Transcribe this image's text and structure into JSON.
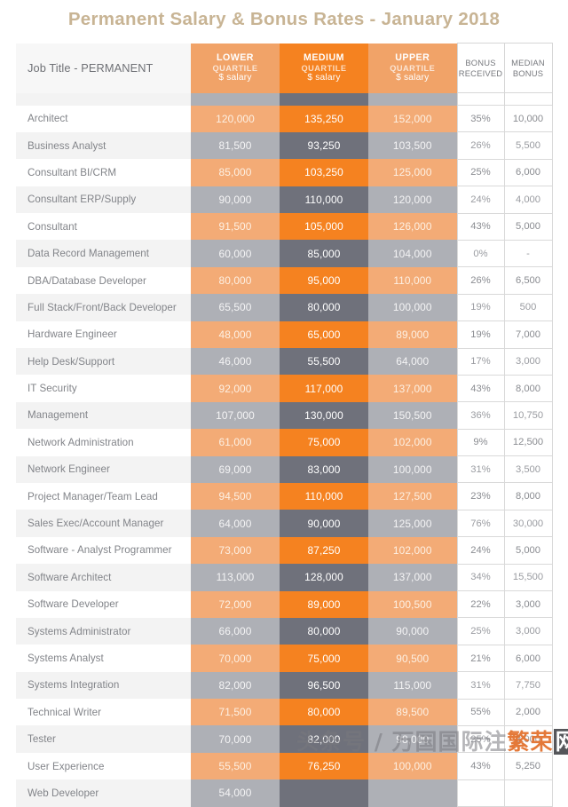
{
  "title": "Permanent Salary & Bonus Rates - January 2018",
  "table": {
    "headers": {
      "job_title": "Job Title - PERMANENT",
      "lower": {
        "l1": "LOWER",
        "l2": "QUARTILE",
        "l3": "$ salary"
      },
      "medium": {
        "l1": "MEDIUM",
        "l2": "QUARTILE",
        "l3": "$ salary"
      },
      "upper": {
        "l1": "UPPER",
        "l2": "QUARTILE",
        "l3": "$ salary"
      },
      "bonus_received": {
        "l1": "BONUS",
        "l2": "RECEIVED"
      },
      "median_bonus": {
        "l1": "MEDIAN",
        "l2": "BONUS"
      }
    },
    "rows": [
      {
        "job": "Architect",
        "lower": "120,000",
        "medium": "135,250",
        "upper": "152,000",
        "bonus": "35%",
        "median": "10,000"
      },
      {
        "job": "Business Analyst",
        "lower": "81,500",
        "medium": "93,250",
        "upper": "103,500",
        "bonus": "26%",
        "median": "5,500"
      },
      {
        "job": "Consultant BI/CRM",
        "lower": "85,000",
        "medium": "103,250",
        "upper": "125,000",
        "bonus": "25%",
        "median": "6,000"
      },
      {
        "job": "Consultant ERP/Supply",
        "lower": "90,000",
        "medium": "110,000",
        "upper": "120,000",
        "bonus": "24%",
        "median": "4,000"
      },
      {
        "job": "Consultant",
        "lower": "91,500",
        "medium": "105,000",
        "upper": "126,000",
        "bonus": "43%",
        "median": "5,000"
      },
      {
        "job": "Data Record Management",
        "lower": "60,000",
        "medium": "85,000",
        "upper": "104,000",
        "bonus": "0%",
        "median": "-"
      },
      {
        "job": "DBA/Database Developer",
        "lower": "80,000",
        "medium": "95,000",
        "upper": "110,000",
        "bonus": "26%",
        "median": "6,500"
      },
      {
        "job": "Full Stack/Front/Back Developer",
        "lower": "65,500",
        "medium": "80,000",
        "upper": "100,000",
        "bonus": "19%",
        "median": "500"
      },
      {
        "job": "Hardware Engineer",
        "lower": "48,000",
        "medium": "65,000",
        "upper": "89,000",
        "bonus": "19%",
        "median": "7,000"
      },
      {
        "job": "Help Desk/Support",
        "lower": "46,000",
        "medium": "55,500",
        "upper": "64,000",
        "bonus": "17%",
        "median": "3,000"
      },
      {
        "job": "IT Security",
        "lower": "92,000",
        "medium": "117,000",
        "upper": "137,000",
        "bonus": "43%",
        "median": "8,000"
      },
      {
        "job": "Management",
        "lower": "107,000",
        "medium": "130,000",
        "upper": "150,500",
        "bonus": "36%",
        "median": "10,750"
      },
      {
        "job": "Network Administration",
        "lower": "61,000",
        "medium": "75,000",
        "upper": "102,000",
        "bonus": "9%",
        "median": "12,500"
      },
      {
        "job": "Network Engineer",
        "lower": "69,000",
        "medium": "83,000",
        "upper": "100,000",
        "bonus": "31%",
        "median": "3,500"
      },
      {
        "job": "Project Manager/Team Lead",
        "lower": "94,500",
        "medium": "110,000",
        "upper": "127,500",
        "bonus": "23%",
        "median": "8,000"
      },
      {
        "job": "Sales Exec/Account Manager",
        "lower": "64,000",
        "medium": "90,000",
        "upper": "125,000",
        "bonus": "76%",
        "median": "30,000"
      },
      {
        "job": "Software - Analyst Programmer",
        "lower": "73,000",
        "medium": "87,250",
        "upper": "102,000",
        "bonus": "24%",
        "median": "5,000"
      },
      {
        "job": "Software Architect",
        "lower": "113,000",
        "medium": "128,000",
        "upper": "137,000",
        "bonus": "34%",
        "median": "15,500"
      },
      {
        "job": "Software Developer",
        "lower": "72,000",
        "medium": "89,000",
        "upper": "100,500",
        "bonus": "22%",
        "median": "3,000"
      },
      {
        "job": "Systems Administrator",
        "lower": "66,000",
        "medium": "80,000",
        "upper": "90,000",
        "bonus": "25%",
        "median": "3,000"
      },
      {
        "job": "Systems Analyst",
        "lower": "70,000",
        "medium": "75,000",
        "upper": "90,500",
        "bonus": "21%",
        "median": "6,000"
      },
      {
        "job": "Systems Integration",
        "lower": "82,000",
        "medium": "96,500",
        "upper": "115,000",
        "bonus": "31%",
        "median": "7,750"
      },
      {
        "job": "Technical Writer",
        "lower": "71,500",
        "medium": "80,000",
        "upper": "89,500",
        "bonus": "55%",
        "median": "2,000"
      },
      {
        "job": "Tester",
        "lower": "70,000",
        "medium": "82,000",
        "upper": "98,000",
        "bonus": "25%",
        "median": "3,000"
      },
      {
        "job": "User Experience",
        "lower": "55,500",
        "medium": "76,250",
        "upper": "100,000",
        "bonus": "43%",
        "median": "5,250"
      },
      {
        "job": "Web Developer",
        "lower": "54,000",
        "medium": "",
        "upper": "",
        "bonus": "",
        "median": ""
      }
    ]
  },
  "watermark": {
    "part1": "头条号 / 万国国际注",
    "part2": "繁荣",
    "part3": "网"
  },
  "colors": {
    "title": "#c8b494",
    "orange_light": "#f3ab76",
    "orange_dark": "#f58220",
    "grey_light": "#aeb0b6",
    "grey_dark": "#6f717b"
  }
}
